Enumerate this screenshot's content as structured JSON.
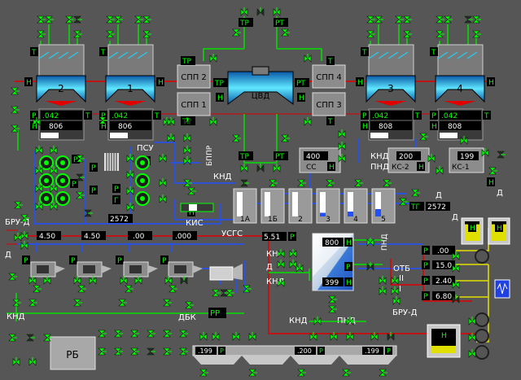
{
  "colors": {
    "background": "#565656",
    "pipe_green": "#00e000",
    "pipe_red": "#e00000",
    "pipe_blue": "#2050ff",
    "pipe_yellow": "#e0e000",
    "turbine_cyan": "#20c8e8",
    "valve_open": "#00ff00",
    "tag_bg": "#000000",
    "tag_fg": "#00ff00"
  },
  "tags": {
    "t": "Т",
    "p": "Р",
    "h": "Н",
    "g": "Г",
    "tr": "ТР",
    "rt": "РТ",
    "tg": "ТГ"
  },
  "turbines": [
    {
      "label": "2",
      "pressure": ".042",
      "level": "806"
    },
    {
      "label": "1",
      "pressure": ".042",
      "level": "806"
    },
    {
      "label": "ЦВД"
    },
    {
      "label": "3",
      "pressure": ".042",
      "level": "808"
    },
    {
      "label": "4",
      "pressure": ".042",
      "level": "808"
    }
  ],
  "separators": [
    "СПП 2",
    "СПП 1",
    "СПП 4",
    "СПП 3"
  ],
  "labels": {
    "psu": "ПСУ",
    "bppr": "БППР",
    "knd": "КНД",
    "pnd": "ПНД",
    "kis": "КИС",
    "usgs": "УСГС",
    "bru_d": "БРУ-Д",
    "d": "Д",
    "kn": "КН",
    "dbk": "ДБК",
    "otb": "ОТБ",
    "roman_2": "II",
    "roman_1": "I",
    "rb": "РБ",
    "pp": "РР"
  },
  "heaters": [
    "1А",
    "1Б",
    "2",
    "3",
    "4",
    "5"
  ],
  "heater_levels": [
    0.0,
    0.0,
    0.0,
    0.15,
    0.2,
    0.3
  ],
  "readouts": {
    "cc": {
      "value": "400",
      "unit": "СС"
    },
    "ks2": {
      "value": "200",
      "unit": "КС-2"
    },
    "ks1": {
      "value": "199",
      "unit": "КС-1"
    },
    "left_2572": "2572",
    "right_2572": "2572",
    "deaerator_pressure": "5.51",
    "deaerator_level": "800",
    "deaerator_bottom": "399",
    "feed_pumps": [
      "4.50",
      "4.50",
      ".00",
      ".000"
    ],
    "pressures_right": [
      ".00",
      "15.0",
      "2.40",
      "6.80"
    ],
    "bottom_bar": [
      ".199",
      ".200",
      ".199"
    ]
  },
  "condenser_top_levels": [
    0.85,
    0.85
  ],
  "rb_tank_level": 0.3
}
